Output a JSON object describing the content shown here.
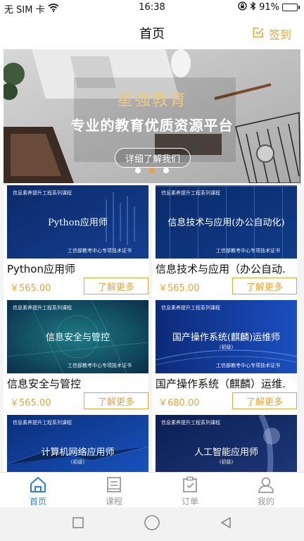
{
  "status_bar": {
    "carrier": "无 SIM 卡",
    "time": "16:38",
    "battery": "91%",
    "battery_level": 0.91
  },
  "header": {
    "title": "首页",
    "checkin_label": "签到"
  },
  "banner": {
    "brand": "星强教育",
    "slogan": "专业的教育优质资源平台",
    "button_label": "详细了解我们",
    "active_slide": 2,
    "slide_count": 3
  },
  "courses": [
    {
      "series": "信息素养提升工程系列课程",
      "thumb_title": "Python应用师",
      "level": "",
      "cert": "工信部教考中心专项技术证书",
      "name": "Python应用师",
      "price": "￥565.00",
      "button": "了解更多"
    },
    {
      "series": "信息素养提升工程系列课程",
      "thumb_title": "信息技术与应用(办公自动化)",
      "level": "",
      "cert": "工信部教考中心专项技术证书",
      "name": "信息技术与应用（办公自动.",
      "price": "￥565.00",
      "button": "了解更多"
    },
    {
      "series": "信息素养提升工程系列课程",
      "thumb_title": "信息安全与管控",
      "level": "",
      "cert": "工信部教考中心专项技术证书",
      "name": "信息安全与管控",
      "price": "￥565.00",
      "button": "了解更多"
    },
    {
      "series": "信息素养提升工程系列课程",
      "thumb_title": "国产操作系统(麒麟)运维师",
      "level": "(初级)",
      "cert": "工信部教考中心专项技术证书",
      "name": "国产操作系统（麒麟）运维.",
      "price": "￥680.00",
      "button": "了解更多"
    },
    {
      "series": "信息素养提升工程系列课程",
      "thumb_title": "计算机网络应用师",
      "level": "(初级)",
      "cert": "",
      "name": "",
      "price": "",
      "button": ""
    },
    {
      "series": "信息素养提升工程系列课程",
      "thumb_title": "人工智能应用师",
      "level": "(初级)",
      "cert": "",
      "name": "",
      "price": "",
      "button": ""
    }
  ],
  "tabbar": {
    "tabs": [
      {
        "label": "首页",
        "icon": "home-icon",
        "active": true
      },
      {
        "label": "课程",
        "icon": "book-icon",
        "active": false
      },
      {
        "label": "订单",
        "icon": "clipboard-icon",
        "active": false
      },
      {
        "label": "我的",
        "icon": "user-icon",
        "active": false
      }
    ]
  },
  "colors": {
    "accent": "#e3a53a",
    "tab_active": "#2f7fd6",
    "tab_inactive": "#9a9a9a",
    "battery_fill": "#3ac34a"
  }
}
